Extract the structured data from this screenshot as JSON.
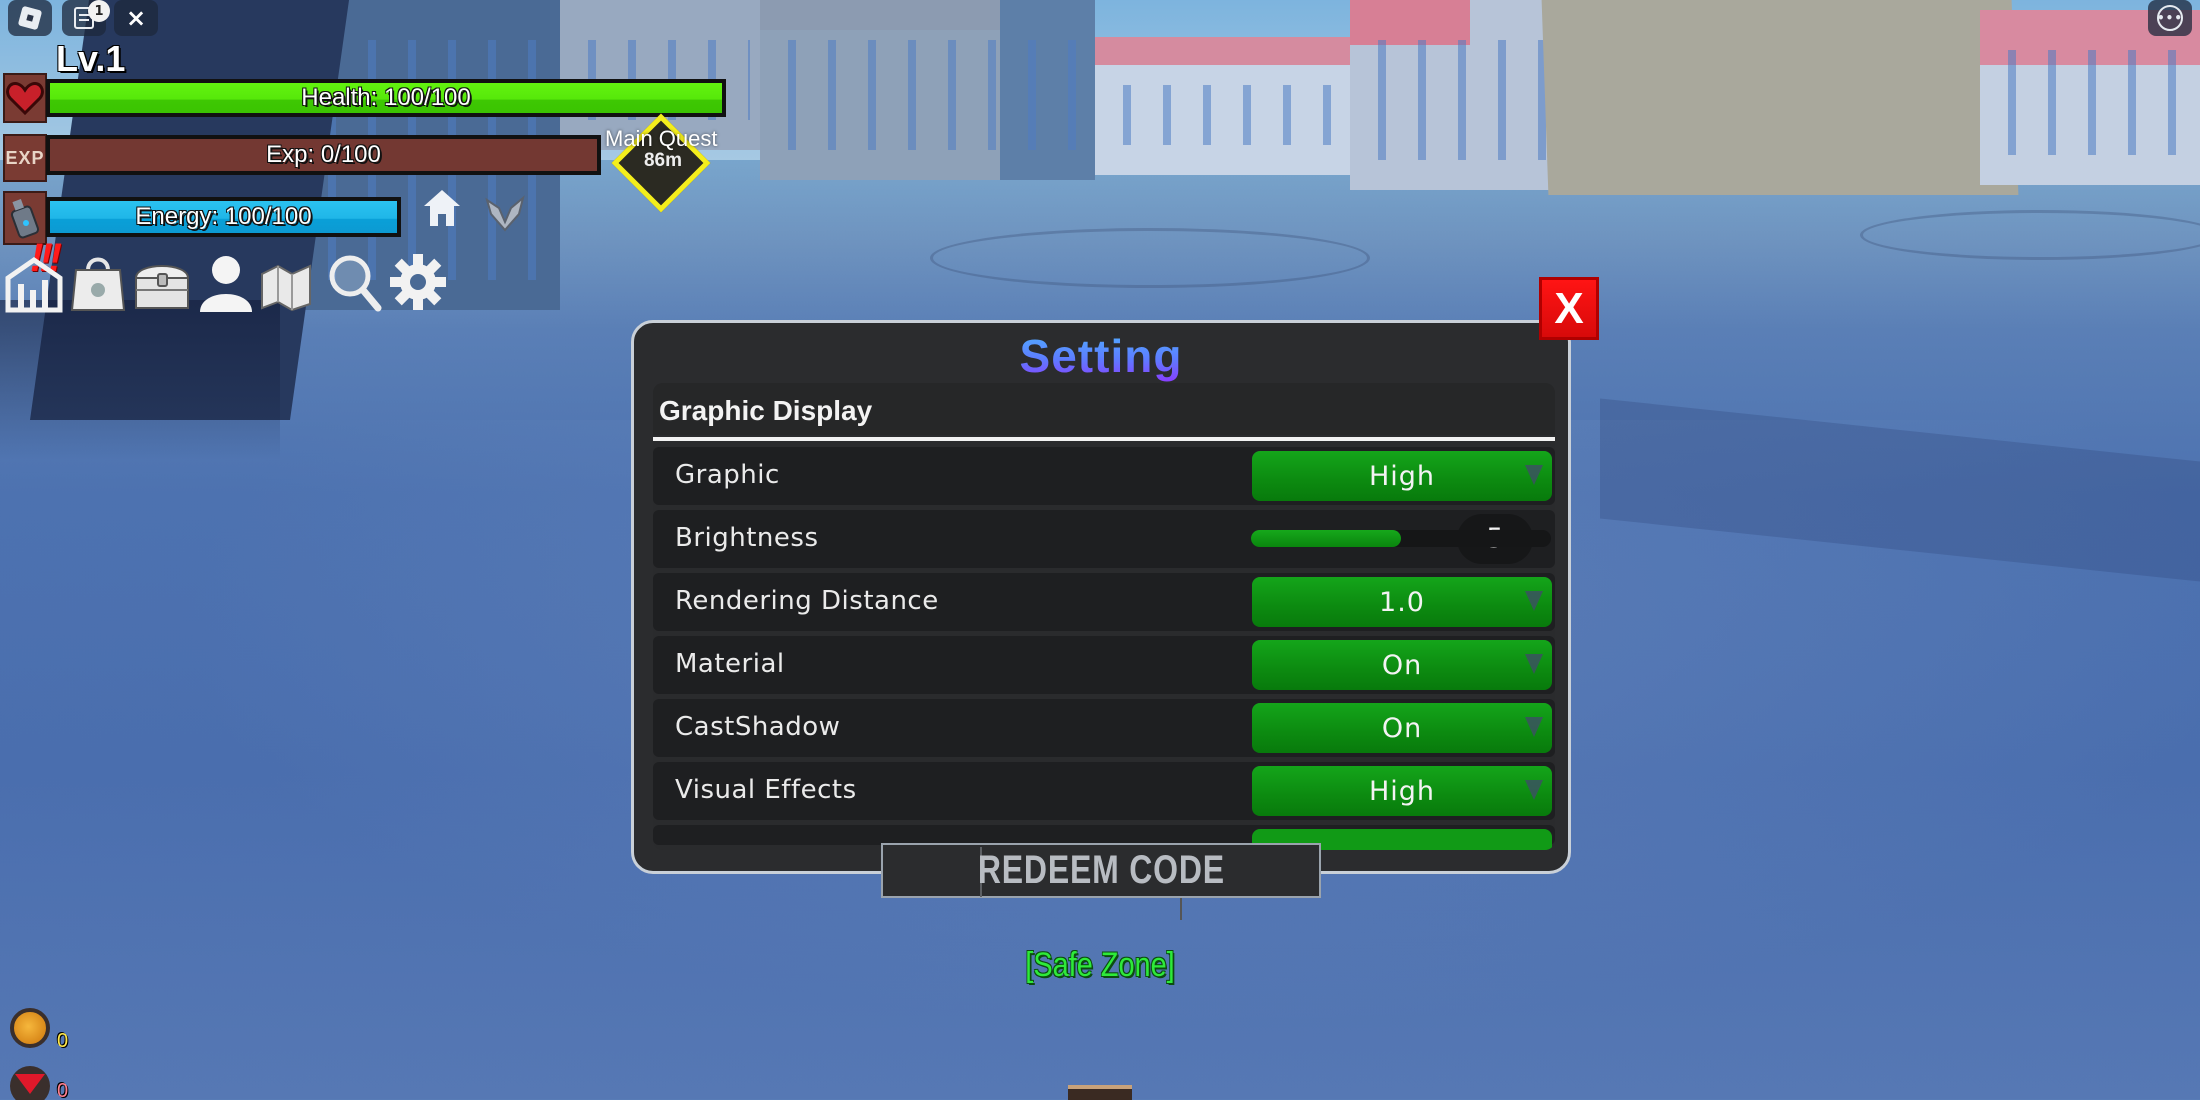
{
  "roblox_topbar": {
    "chat_badge_count": "1",
    "close_glyph": "×",
    "more_glyph": "•••"
  },
  "hud": {
    "level": "Lv.1",
    "exp_icon_text": "EXP",
    "health": {
      "label": "Health: 100/100",
      "current": 100,
      "max": 100,
      "color": "#56e80a"
    },
    "exp": {
      "label": "Exp: 0/100",
      "current": 0,
      "max": 100,
      "color": "#733832"
    },
    "energy": {
      "label": "Energy: 100/100",
      "current": 100,
      "max": 100,
      "color": "#1fb6e8"
    },
    "quest": {
      "label": "Main Quest",
      "distance": "86m"
    },
    "alert_marks": "!!!",
    "menu_icons": [
      "stats-icon",
      "shop-bag-icon",
      "chest-icon",
      "profile-icon",
      "map-icon",
      "search-icon",
      "settings-gear-icon"
    ],
    "currency": {
      "beli": "0",
      "gems": "0"
    }
  },
  "settings": {
    "title": "Setting",
    "close_label": "X",
    "section_title": "Graphic Display",
    "rows": [
      {
        "label": "Graphic",
        "type": "dropdown",
        "value": "High"
      },
      {
        "label": "Brightness",
        "type": "slider",
        "value": "5",
        "fraction": 0.5
      },
      {
        "label": "Rendering Distance",
        "type": "dropdown",
        "value": "1.0"
      },
      {
        "label": "Material",
        "type": "dropdown",
        "value": "On"
      },
      {
        "label": "CastShadow",
        "type": "dropdown",
        "value": "On"
      },
      {
        "label": "Visual Effects",
        "type": "dropdown",
        "value": "High"
      }
    ]
  },
  "redeem": {
    "placeholder": "REDEEM CODE"
  },
  "zone": {
    "label": "[Safe Zone]",
    "color": "#2eea3a"
  }
}
